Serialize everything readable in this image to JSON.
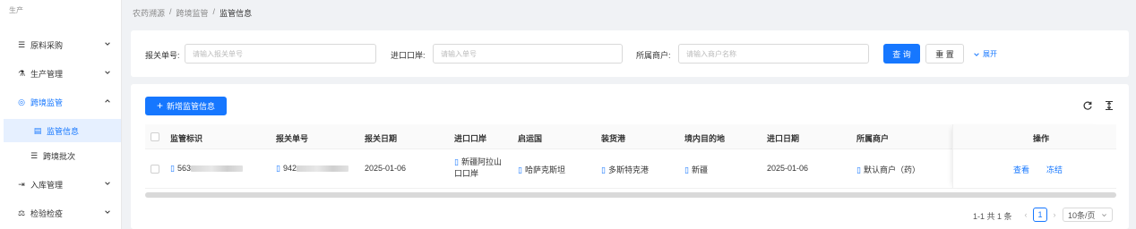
{
  "sidebar": {
    "header": "生产",
    "items": [
      {
        "icon": "list-icon",
        "glyph": "☰",
        "label": "原料采购"
      },
      {
        "icon": "flask-icon",
        "glyph": "⚗",
        "label": "生产管理"
      },
      {
        "icon": "globe-icon",
        "glyph": "◎",
        "label": "跨境监管"
      },
      {
        "icon": "document-check-icon",
        "glyph": "▤",
        "label": "监管信息"
      },
      {
        "icon": "list-icon",
        "glyph": "☰",
        "label": "跨境批次"
      },
      {
        "icon": "login-icon",
        "glyph": "⇥",
        "label": "入库管理"
      },
      {
        "icon": "inspect-icon",
        "glyph": "⚖",
        "label": "检验检疫"
      }
    ]
  },
  "breadcrumb": {
    "items": [
      "农药溯源",
      "跨境监管",
      "监管信息"
    ],
    "sep": "/"
  },
  "filter": {
    "declaration_label": "报关单号:",
    "declaration_placeholder": "请输入报关单号",
    "port_label": "进口口岸:",
    "port_placeholder": "请输入单号",
    "merchant_label": "所属商户:",
    "merchant_placeholder": "请输入商户名称",
    "search_label": "查 询",
    "reset_label": "重 置",
    "expand_label": "展开"
  },
  "table": {
    "add_label": "新增监管信息",
    "headers": [
      "监管标识",
      "报关单号",
      "报关日期",
      "进口口岸",
      "启运国",
      "装货港",
      "境内目的地",
      "进口日期",
      "所属商户",
      "操作"
    ],
    "rows": [
      {
        "supervision_id": "563",
        "declaration_no": "942",
        "declaration_date": "2025-01-06",
        "port_line1": "新疆阿拉山",
        "port_line2": "口口岸",
        "origin_country": "哈萨克斯坦",
        "loading_port": "多斯特克港",
        "destination": "新疆",
        "import_date": "2025-01-06",
        "merchant": "默认商户（药）",
        "view_label": "查看",
        "freeze_label": "冻结"
      }
    ]
  },
  "pagination": {
    "summary": "1-1 共 1 条",
    "current_page": "1",
    "page_size": "10条/页"
  },
  "colors": {
    "primary": "#1677ff",
    "selected_bg": "#e6f0ff",
    "page_bg": "#f0f2f5"
  }
}
